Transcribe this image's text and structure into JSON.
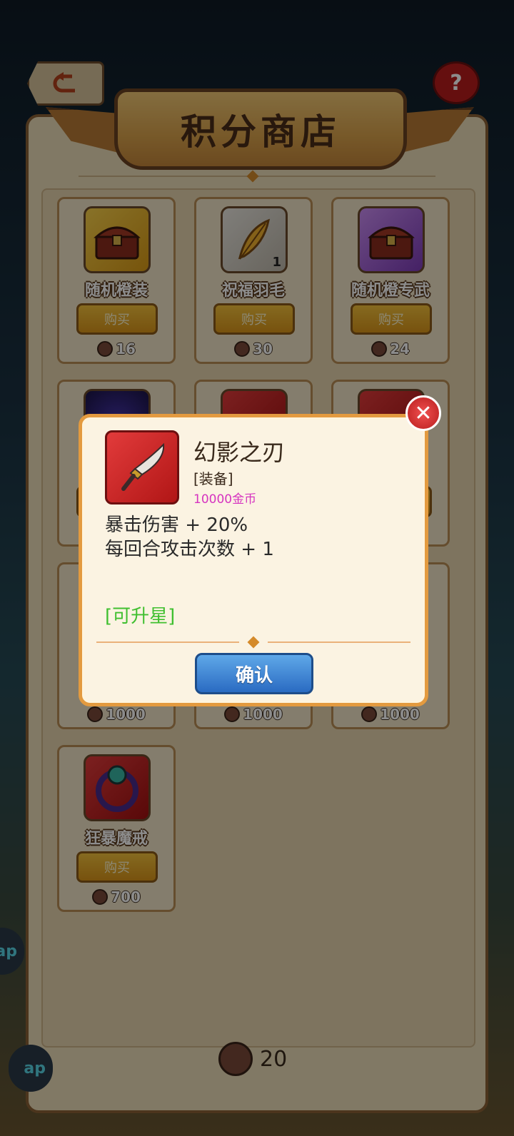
{
  "header": {
    "title": "积分商店",
    "help_label": "?"
  },
  "shop_items": [
    {
      "name": "随机橙装",
      "buy": "购买",
      "price": "16",
      "icon": "treasure-chest-icon",
      "quantity": ""
    },
    {
      "name": "祝福羽毛",
      "buy": "购买",
      "price": "30",
      "icon": "feather-icon",
      "quantity": "1"
    },
    {
      "name": "随机橙专武",
      "buy": "购买",
      "price": "24",
      "icon": "treasure-chest-icon",
      "quantity": ""
    },
    {
      "name": "",
      "buy": "购买",
      "price": "1000",
      "icon": "dark-orb-icon",
      "quantity": ""
    },
    {
      "name": "",
      "buy": "购买",
      "price": "1000",
      "icon": "gold-item-icon",
      "quantity": ""
    },
    {
      "name": "",
      "buy": "购买",
      "price": "1000",
      "icon": "red-item-icon",
      "quantity": ""
    },
    {
      "name": "狂暴魔戒",
      "buy": "购买",
      "price": "700",
      "icon": "ring-icon",
      "quantity": ""
    }
  ],
  "side_tab": {
    "label": "ap"
  },
  "currency": {
    "amount": "20"
  },
  "popup": {
    "name": "幻影之刃",
    "type": "[装备]",
    "cost": "10000金币",
    "stat1": "暴击伤害 + 20%",
    "stat2": "每回合攻击次数 + 1",
    "upgrade": "[可升星]",
    "confirm": "确认",
    "close": "✕"
  },
  "colors": {
    "accent_orange": "#e39a3f",
    "confirm_blue": "#2a6bc2",
    "cost_magenta": "#d633c0",
    "upgrade_green": "#3fbf2f"
  }
}
